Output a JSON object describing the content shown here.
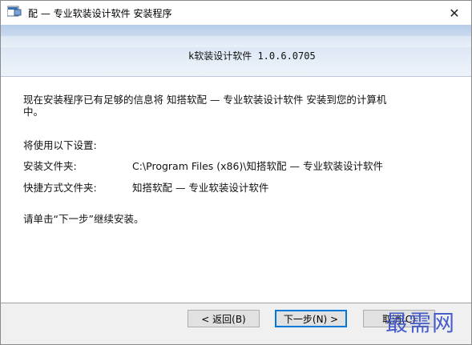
{
  "window": {
    "title": "配 — 专业软装设计软件 安装程序",
    "close_symbol": "✕"
  },
  "banner": {
    "text": "k软装设计软件 1.0.6.0705"
  },
  "body": {
    "intro": "现在安装程序已有足够的信息将 知搭软配 — 专业软装设计软件 安装到您的计算机\n中。",
    "settings_title": "将使用以下设置:",
    "install_folder_label": "安装文件夹:",
    "install_folder_value": "C:\\Program Files (x86)\\知搭软配 — 专业软装设计软件",
    "shortcut_folder_label": "快捷方式文件夹:",
    "shortcut_folder_value": "知搭软配 — 专业软装设计软件",
    "prompt": "请单击“下一步”继续安装。"
  },
  "buttons": {
    "back": "< 返回(B)",
    "next": "下一步(N) >",
    "cancel": "取消(C)"
  },
  "watermark": {
    "text": "最需网"
  },
  "colors": {
    "accent": "#0078d7",
    "watermark": "#3a52c8"
  }
}
